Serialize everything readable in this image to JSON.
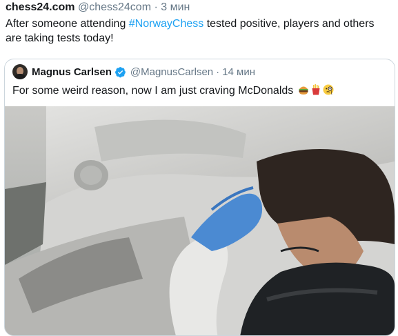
{
  "tweet": {
    "name": "chess24.com",
    "handle": "@chess24com",
    "separator": "·",
    "time": "3 мин",
    "text_before": "After someone attending ",
    "hashtag": "#NorwayChess",
    "text_after": " tested positive, players and others are taking tests today!"
  },
  "quote": {
    "name": "Magnus Carlsen",
    "handle": "@MagnusCarlsen",
    "separator": "·",
    "time": "14 мин",
    "text": "For some weird reason, now I am just craving McDonalds",
    "emojis": [
      "hamburger-emoji",
      "french-fries-emoji",
      "face-with-monocle-emoji"
    ],
    "media": {
      "icon": "photo",
      "colors": {
        "glove": "#4b8ad2",
        "jacket": "#1f2225",
        "hair": "#2e2520",
        "car_roof": "#cfcfcf"
      }
    }
  },
  "colors": {
    "accent": "#1da1f2",
    "muted": "#657786",
    "border": "#ccd6dd"
  }
}
